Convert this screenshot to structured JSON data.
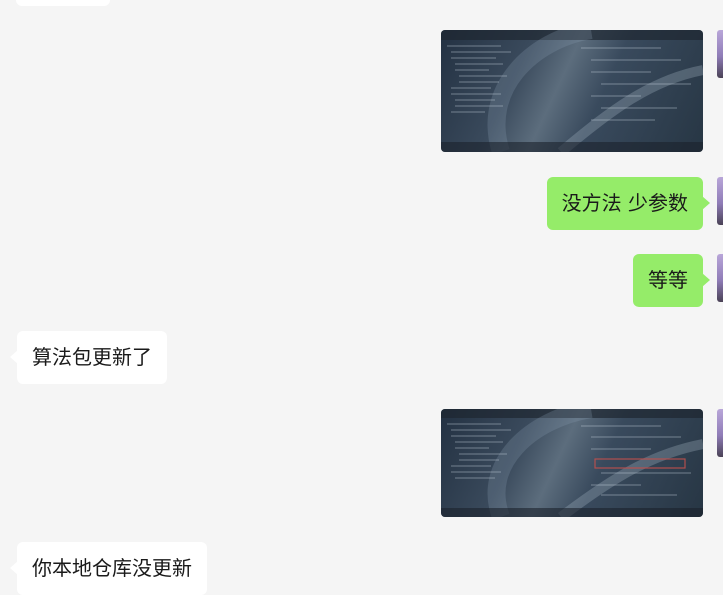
{
  "chat": {
    "messages": [
      {
        "side": "other",
        "type": "text",
        "text": ""
      },
      {
        "side": "me",
        "type": "image",
        "image_name": "ide-screenshot-1"
      },
      {
        "side": "me",
        "type": "text",
        "text": "没方法 少参数"
      },
      {
        "side": "me",
        "type": "text",
        "text": "等等"
      },
      {
        "side": "other",
        "type": "text",
        "text": "算法包更新了"
      },
      {
        "side": "me",
        "type": "image",
        "image_name": "ide-screenshot-2"
      },
      {
        "side": "other",
        "type": "text",
        "text": "你本地仓库没更新"
      }
    ]
  },
  "colors": {
    "background": "#f5f5f5",
    "my_bubble": "#95ec69",
    "other_bubble": "#ffffff"
  }
}
